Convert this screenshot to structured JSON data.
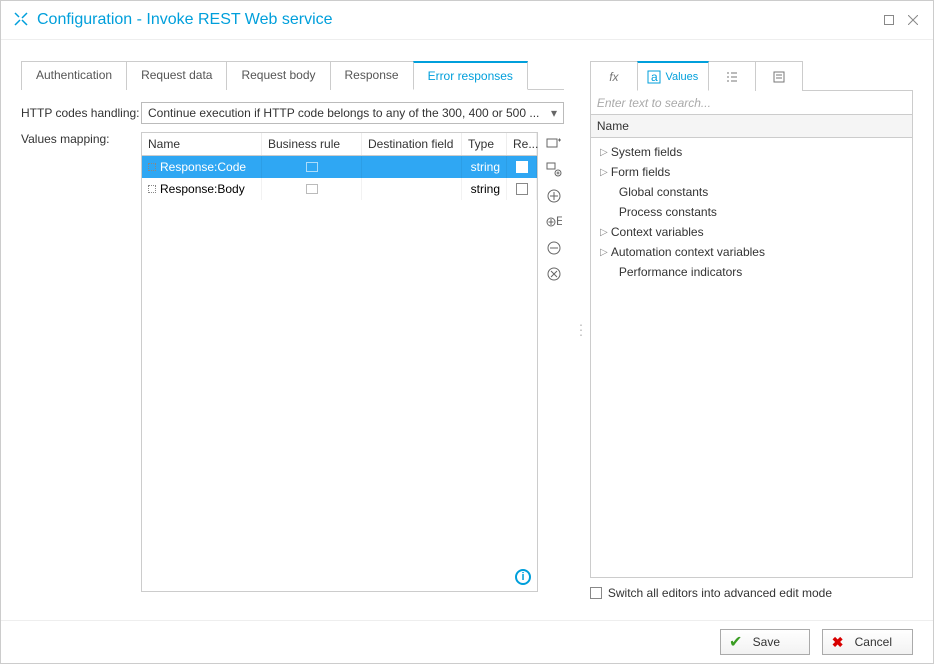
{
  "window": {
    "title": "Configuration - Invoke REST Web service"
  },
  "tabs": [
    {
      "label": "Authentication"
    },
    {
      "label": "Request data"
    },
    {
      "label": "Request body"
    },
    {
      "label": "Response"
    },
    {
      "label": "Error responses"
    }
  ],
  "activeTabIndex": 4,
  "form": {
    "httpHandlingLabel": "HTTP codes handling:",
    "httpHandlingValue": "Continue execution if HTTP code belongs to any of the 300, 400 or 500 ...",
    "valuesMappingLabel": "Values mapping:"
  },
  "mappingColumns": {
    "name": "Name",
    "rule": "Business rule",
    "dest": "Destination field",
    "type": "Type",
    "re": "Re..."
  },
  "mappingRows": [
    {
      "name": "Response:Code",
      "type": "string",
      "selected": true
    },
    {
      "name": "Response:Body",
      "type": "string",
      "selected": false
    }
  ],
  "rightTabs": {
    "valuesLabel": "Values"
  },
  "search": {
    "placeholder": "Enter text to search..."
  },
  "treeHeader": "Name",
  "treeItems": [
    {
      "label": "System fields",
      "expandable": true
    },
    {
      "label": "Form fields",
      "expandable": true
    },
    {
      "label": "Global constants",
      "expandable": false,
      "indent": true
    },
    {
      "label": "Process constants",
      "expandable": false,
      "indent": true
    },
    {
      "label": "Context variables",
      "expandable": true
    },
    {
      "label": "Automation context variables",
      "expandable": true
    },
    {
      "label": "Performance indicators",
      "expandable": false,
      "indent": true
    }
  ],
  "switchLabel": "Switch all editors into advanced edit mode",
  "footer": {
    "save": "Save",
    "cancel": "Cancel"
  }
}
